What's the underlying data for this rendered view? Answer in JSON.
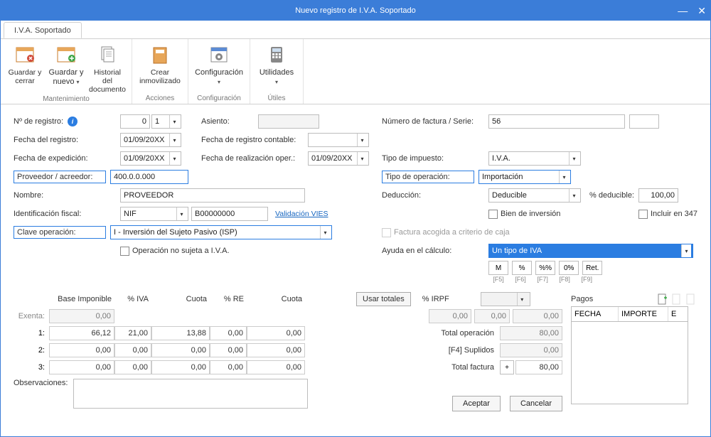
{
  "window": {
    "title": "Nuevo registro de I.V.A. Soportado"
  },
  "tab": {
    "label": "I.V.A. Soportado"
  },
  "ribbon": {
    "groups": [
      {
        "label": "Mantenimiento",
        "buttons": [
          {
            "label": "Guardar y cerrar",
            "chev": false
          },
          {
            "label": "Guardar y nuevo",
            "chev": true
          },
          {
            "label": "Historial del documento",
            "chev": false
          }
        ]
      },
      {
        "label": "Acciones",
        "buttons": [
          {
            "label": "Crear inmovilizado",
            "chev": false
          }
        ]
      },
      {
        "label": "Configuración",
        "buttons": [
          {
            "label": "Configuración",
            "chev": true
          }
        ]
      },
      {
        "label": "Útiles",
        "buttons": [
          {
            "label": "Utilidades",
            "chev": true
          }
        ]
      }
    ]
  },
  "left": {
    "nregistro_label": "Nº de registro:",
    "nregistro_a": "0",
    "nregistro_b": "1",
    "asiento_label": "Asiento:",
    "asiento_val": "",
    "fecha_registro_label": "Fecha del registro:",
    "fecha_registro_val": "01/09/20XX",
    "fecha_reg_contable_label": "Fecha de registro contable:",
    "fecha_reg_contable_val": "",
    "fecha_expedicion_label": "Fecha de expedición:",
    "fecha_expedicion_val": "01/09/20XX",
    "fecha_real_oper_label": "Fecha de realización oper.:",
    "fecha_real_oper_val": "01/09/20XX",
    "proveedor_label": "Proveedor / acreedor:",
    "proveedor_val": "400.0.0.000",
    "nombre_label": "Nombre:",
    "nombre_val": "PROVEEDOR",
    "idfiscal_label": "Identificación fiscal:",
    "idfiscal_tipo": "NIF",
    "idfiscal_num": "B00000000",
    "vies_link": "Validación VIES",
    "clave_label": "Clave operación:",
    "clave_val": "I - Inversión del Sujeto Pasivo (ISP)",
    "no_sujeta_label": "Operación no sujeta a I.V.A."
  },
  "right": {
    "numfact_label": "Número de factura / Serie:",
    "numfact_val": "56",
    "serie_val": "",
    "tipo_impuesto_label": "Tipo de impuesto:",
    "tipo_impuesto_val": "I.V.A.",
    "tipo_operacion_label": "Tipo de operación:",
    "tipo_operacion_val": "Importación",
    "deduccion_label": "Deducción:",
    "deduccion_val": "Deducible",
    "pct_deducible_label": "% deducible:",
    "pct_deducible_val": "100,00",
    "bien_inversion_label": "Bien de inversión",
    "incluir347_label": "Incluir en 347",
    "factura_caja_label": "Factura acogida a criterio de caja",
    "ayuda_label": "Ayuda en el cálculo:",
    "ayuda_val": "Un tipo de IVA",
    "quickbtns": [
      "M",
      "%",
      "%%",
      "0%",
      "Ret."
    ],
    "quicklabels": [
      "[F5]",
      "[F6]",
      "[F7]",
      "[F8]",
      "[F9]"
    ]
  },
  "grid": {
    "headers": [
      "Base Imponible",
      "% IVA",
      "Cuota",
      "% RE",
      "Cuota"
    ],
    "usar_totales": "Usar totales",
    "pct_irpf": "% IRPF",
    "exenta_label": "Exenta:",
    "rows_labels": [
      "1:",
      "2:",
      "3:"
    ],
    "exenta": [
      "0,00"
    ],
    "r1": [
      "66,12",
      "21,00",
      "13,88",
      "0,00",
      "0,00"
    ],
    "r2": [
      "0,00",
      "0,00",
      "0,00",
      "0,00",
      "0,00"
    ],
    "r3": [
      "0,00",
      "0,00",
      "0,00",
      "0,00",
      "0,00"
    ],
    "irpf_row": [
      "0,00",
      "0,00",
      "0,00"
    ],
    "total_oper_label": "Total operación",
    "total_oper_val": "80,00",
    "suplidos_label": "[F4] Suplidos",
    "suplidos_val": "0,00",
    "total_fact_label": "Total factura",
    "total_fact_val": "80,00",
    "observaciones_label": "Observaciones:",
    "pagos_label": "Pagos",
    "pagos_cols": [
      "FECHA",
      "IMPORTE",
      "E"
    ]
  },
  "buttons": {
    "aceptar": "Aceptar",
    "cancelar": "Cancelar"
  }
}
